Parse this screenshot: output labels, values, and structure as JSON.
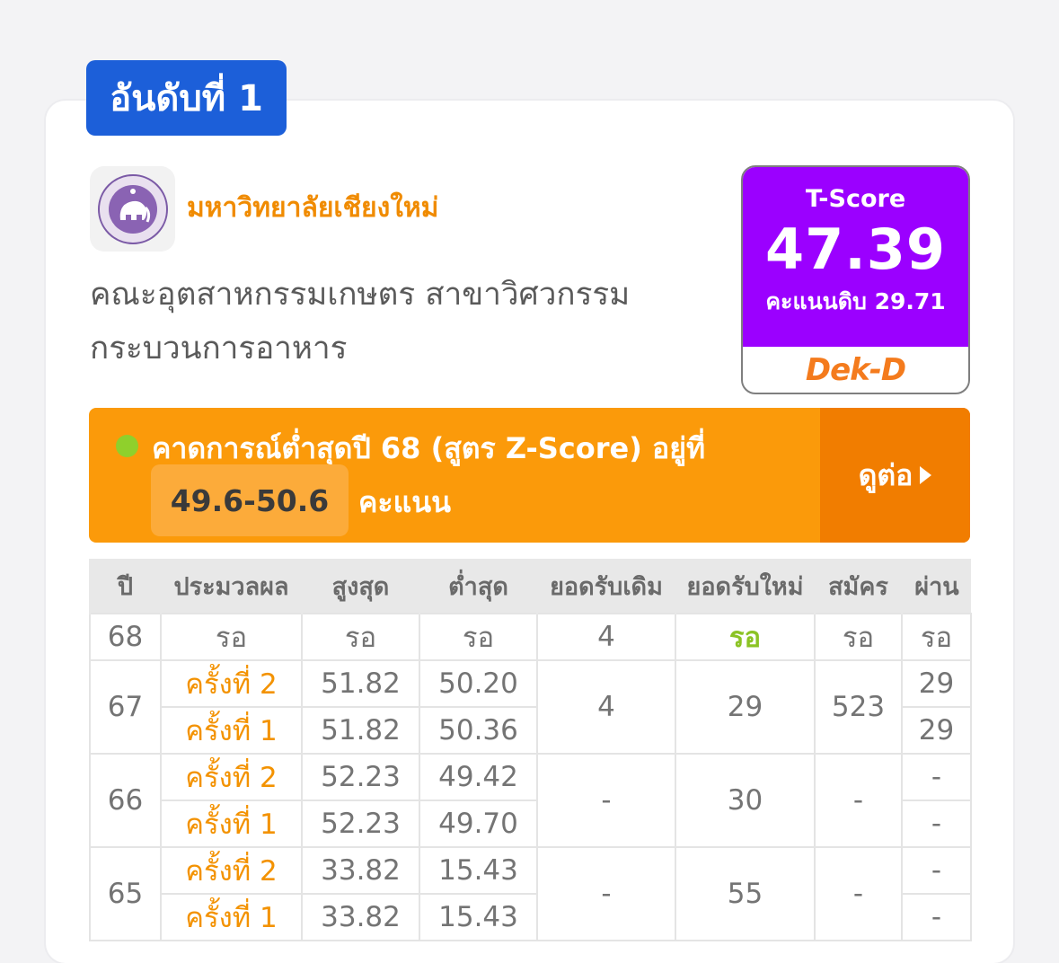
{
  "rank_label": "อันดับที่ 1",
  "university": {
    "name": "มหาวิทยาลัยเชียงใหม่",
    "logo_icon": "elephant-seal-icon",
    "seal_text": "มหาวิทยาลัยเชียงใหม่"
  },
  "faculty": "คณะอุตสาหกรรมเกษตร สาขาวิศวกรรมกระบวนการอาหาร",
  "tscore": {
    "label": "T-Score",
    "value": "47.39",
    "raw": "คะแนนดิบ 29.71",
    "brand": "Dek-D",
    "color": "#9b00ff"
  },
  "prediction": {
    "text": "คาดการณ์ต่ำสุดปี 68 (สูตร Z-Score) อยู่ที่",
    "range": "49.6-50.6",
    "unit": "คะแนน",
    "more_label": "ดูต่อ",
    "color": "#fb9a0a",
    "accent": "#f17d00"
  },
  "table": {
    "headers": [
      "ปี",
      "ประมวลผล",
      "สูงสุด",
      "ต่ำสุด",
      "ยอดรับเดิม",
      "ยอดรับใหม่",
      "สมัคร",
      "ผ่าน"
    ],
    "rows": [
      {
        "year": "68",
        "process": "รอ",
        "max": "รอ",
        "min": "รอ",
        "orig": "4",
        "new": "รอ",
        "apply": "รอ",
        "pass": "รอ"
      },
      {
        "year": "67",
        "orig": "4",
        "new": "29",
        "apply": "523",
        "rounds": [
          {
            "process": "ครั้งที่ 2",
            "max": "51.82",
            "min": "50.20",
            "pass": "29"
          },
          {
            "process": "ครั้งที่ 1",
            "max": "51.82",
            "min": "50.36",
            "pass": "29"
          }
        ]
      },
      {
        "year": "66",
        "orig": "-",
        "new": "30",
        "apply": "-",
        "rounds": [
          {
            "process": "ครั้งที่ 2",
            "max": "52.23",
            "min": "49.42",
            "pass": "-"
          },
          {
            "process": "ครั้งที่ 1",
            "max": "52.23",
            "min": "49.70",
            "pass": "-"
          }
        ]
      },
      {
        "year": "65",
        "orig": "-",
        "new": "55",
        "apply": "-",
        "rounds": [
          {
            "process": "ครั้งที่ 2",
            "max": "33.82",
            "min": "15.43",
            "pass": "-"
          },
          {
            "process": "ครั้งที่ 1",
            "max": "33.82",
            "min": "15.43",
            "pass": "-"
          }
        ]
      }
    ]
  }
}
